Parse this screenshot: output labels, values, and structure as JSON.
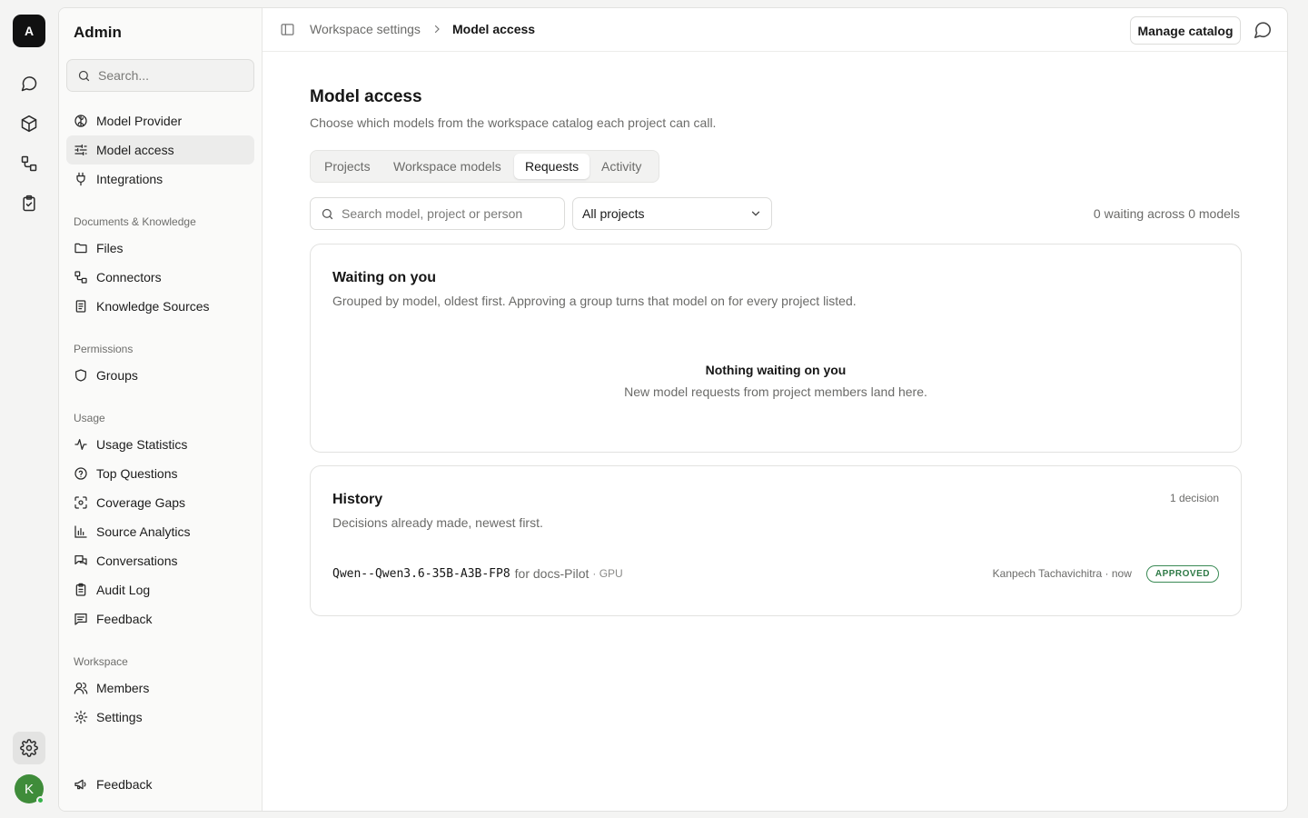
{
  "rail": {
    "logo": "A",
    "avatar": "K",
    "icons": [
      "chat-icon",
      "box-icon",
      "workflow-icon",
      "clipboard-check-icon",
      "gear-icon"
    ]
  },
  "sidebar": {
    "title": "Admin",
    "search_placeholder": "Search...",
    "items": [
      {
        "label": "Model Provider",
        "icon": "brain-icon"
      },
      {
        "label": "Model access",
        "icon": "sliders-icon",
        "active": true
      },
      {
        "label": "Integrations",
        "icon": "plug-icon"
      }
    ],
    "sections": [
      {
        "heading": "Documents & Knowledge",
        "items": [
          {
            "label": "Files",
            "icon": "folder-icon"
          },
          {
            "label": "Connectors",
            "icon": "connector-icon"
          },
          {
            "label": "Knowledge Sources",
            "icon": "book-icon"
          }
        ]
      },
      {
        "heading": "Permissions",
        "items": [
          {
            "label": "Groups",
            "icon": "shield-icon"
          }
        ]
      },
      {
        "heading": "Usage",
        "items": [
          {
            "label": "Usage Statistics",
            "icon": "activity-icon"
          },
          {
            "label": "Top Questions",
            "icon": "help-circle-icon"
          },
          {
            "label": "Coverage Gaps",
            "icon": "scan-icon"
          },
          {
            "label": "Source Analytics",
            "icon": "bar-chart-icon"
          },
          {
            "label": "Conversations",
            "icon": "messages-icon"
          },
          {
            "label": "Audit Log",
            "icon": "clipboard-list-icon"
          },
          {
            "label": "Feedback",
            "icon": "message-square-text-icon"
          }
        ]
      },
      {
        "heading": "Workspace",
        "items": [
          {
            "label": "Members",
            "icon": "users-icon"
          },
          {
            "label": "Settings",
            "icon": "gear-icon"
          }
        ]
      }
    ],
    "footer_label": "Feedback"
  },
  "topbar": {
    "breadcrumb_parent": "Workspace settings",
    "breadcrumb_current": "Model access",
    "manage_catalog": "Manage catalog"
  },
  "page": {
    "title": "Model access",
    "subtitle": "Choose which models from the workspace catalog each project can call.",
    "tabs": [
      "Projects",
      "Workspace models",
      "Requests",
      "Activity"
    ],
    "active_tab": "Requests",
    "search_placeholder": "Search model, project or person",
    "project_filter": "All projects",
    "summary": "0 waiting across 0 models"
  },
  "waiting": {
    "title": "Waiting on you",
    "subtitle": "Grouped by model, oldest first. Approving a group turns that model on for every project listed.",
    "empty_title": "Nothing waiting on you",
    "empty_subtitle": "New model requests from project members land here."
  },
  "history": {
    "title": "History",
    "subtitle": "Decisions already made, newest first.",
    "count": "1 decision",
    "rows": [
      {
        "model": "Qwen--Qwen3.6-35B-A3B-FP8",
        "for_text": "for docs-Pilot",
        "meta": "· GPU",
        "who": "Kanpech Tachavichitra · now",
        "status": "APPROVED"
      }
    ]
  }
}
